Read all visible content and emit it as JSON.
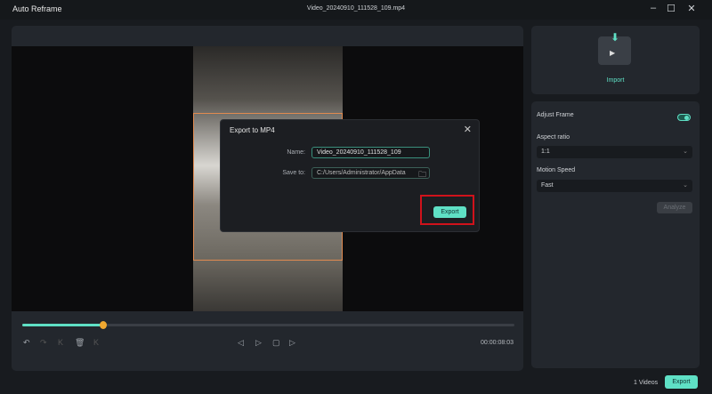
{
  "window": {
    "title": "Auto Reframe",
    "file_name": "Video_20240910_111528_109.mp4"
  },
  "dialog": {
    "title": "Export to MP4",
    "name_label": "Name:",
    "name_value": "Video_20240910_111528_109",
    "save_label": "Save to:",
    "save_value": "C:/Users/Administrator/AppData",
    "export_label": "Export"
  },
  "player": {
    "time": "00:00:08:03",
    "progress_percent": 16.5
  },
  "right": {
    "import_label": "Import",
    "adjust_frame_label": "Adjust Frame",
    "adjust_frame_on": true,
    "aspect_label": "Aspect ratio",
    "aspect_value": "1:1",
    "motion_label": "Motion Speed",
    "motion_value": "Fast",
    "analyze_label": "Analyze"
  },
  "footer": {
    "count": "1 Videos",
    "export_label": "Export"
  },
  "colors": {
    "accent": "#5fe0c5",
    "playhead": "#f0a830",
    "highlight": "#d0121b",
    "crop": "#e08a50"
  }
}
